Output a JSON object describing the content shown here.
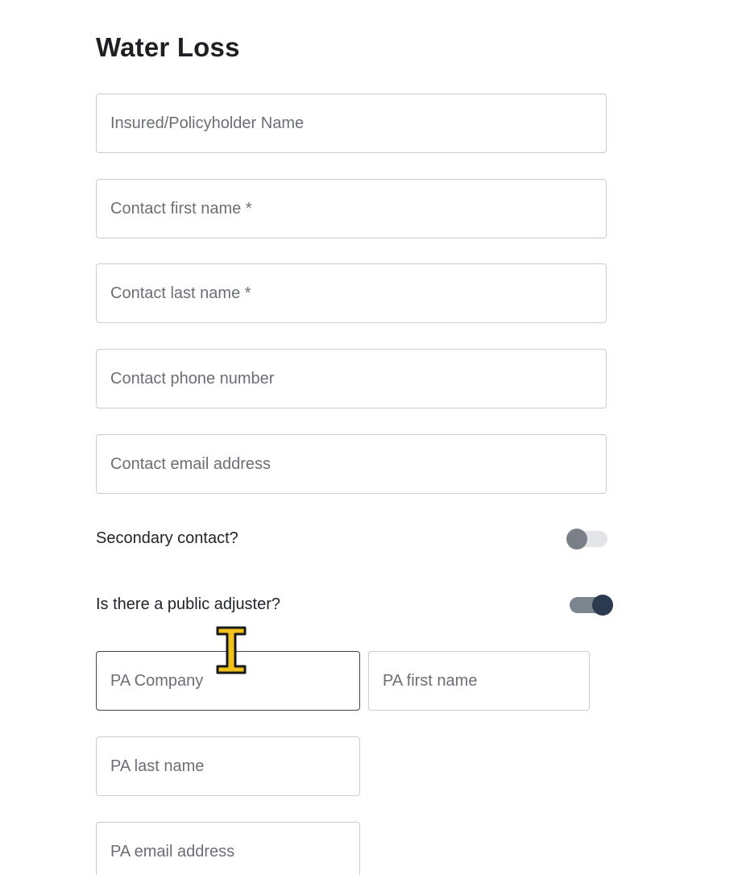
{
  "form": {
    "title": "Water Loss",
    "fields": {
      "insured_name": {
        "placeholder": "Insured/Policyholder Name",
        "value": ""
      },
      "contact_first_name": {
        "placeholder": "Contact first name *",
        "value": ""
      },
      "contact_last_name": {
        "placeholder": "Contact last name *",
        "value": ""
      },
      "contact_phone": {
        "placeholder": "Contact phone number",
        "value": ""
      },
      "contact_email": {
        "placeholder": "Contact email address",
        "value": ""
      }
    },
    "toggles": {
      "secondary_contact": {
        "label": "Secondary contact?",
        "state": "off"
      },
      "public_adjuster": {
        "label": "Is there a public adjuster?",
        "state": "on"
      }
    },
    "pa_fields": {
      "company": {
        "placeholder": "PA Company",
        "value": ""
      },
      "first_name": {
        "placeholder": "PA first name",
        "value": ""
      },
      "last_name": {
        "placeholder": "PA last name",
        "value": ""
      },
      "email": {
        "placeholder": "PA email address",
        "value": ""
      }
    }
  },
  "colors": {
    "toggle_on_knob": "#2b3a4f",
    "toggle_off_knob": "#7b8088",
    "focused_border": "#3b4450",
    "field_border": "#c9ccd1"
  },
  "cursor": {
    "icon": "text-cursor-icon"
  }
}
